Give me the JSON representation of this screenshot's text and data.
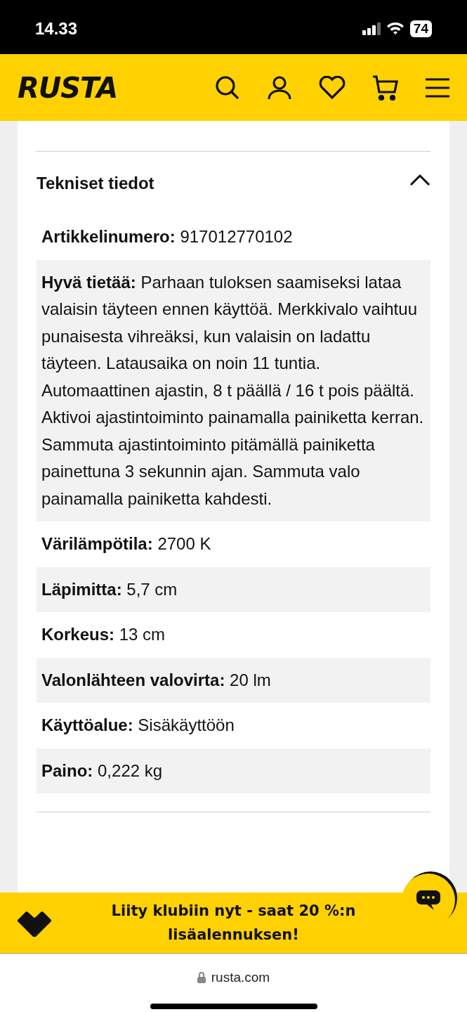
{
  "status_bar": {
    "time": "14.33",
    "battery": "74"
  },
  "header": {
    "logo": "RUSTA"
  },
  "section": {
    "title": "Tekniset tiedot",
    "expanded": true,
    "rows": [
      "**Artikkelinumero:** 917012770102",
      "**Hyvä tietää:** Parhaan tuloksen saamiseksi lataa valaisin täyteen ennen käyttöä. Merkkivalo vaihtuu punaisesta vihreäksi, kun valaisin on ladattu täyteen. Latausaika on noin 11 tuntia. Automaattinen ajastin, 8 t päällä / 16 t pois päältä. Aktivoi ajastintoiminto painamalla painiketta kerran. Sammuta ajastintoiminto pitämällä painiketta painettuna 3 sekunnin ajan. Sammuta valo painamalla painiketta kahdesti.",
      "**Värilämpötila:** 2700 K",
      "**Läpimitta:** 5,7 cm",
      "**Korkeus:** 13 cm",
      "**Valonlähteen valovirta:** 20 lm",
      "**Käyttöalue:** Sisäkäyttöön",
      "**Paino:** 0,222 kg"
    ]
  },
  "banner": {
    "text": "Liity klubiin nyt - saat 20 %:n lisäalennuksen!"
  },
  "browser": {
    "url": "rusta.com"
  }
}
